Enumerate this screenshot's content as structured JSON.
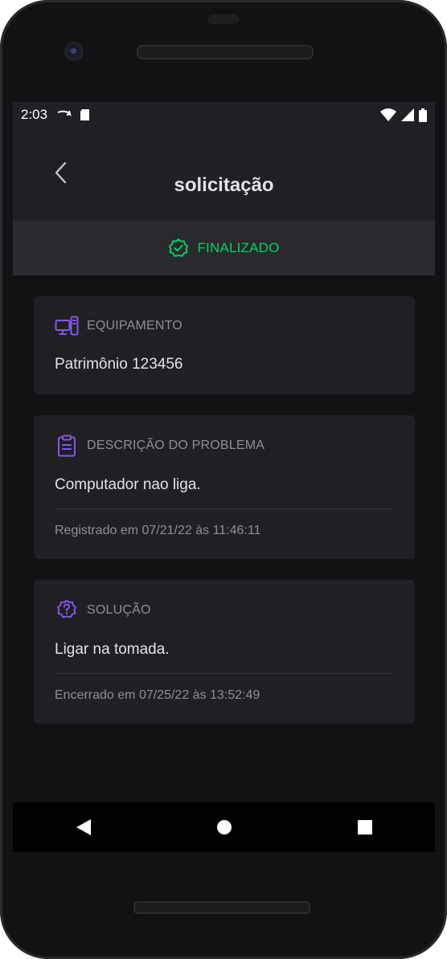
{
  "statusbar": {
    "time": "2:03"
  },
  "header": {
    "title": "solicitação"
  },
  "status": {
    "label": "FINALIZADO",
    "color": "#04d361"
  },
  "cards": [
    {
      "heading": "EQUIPAMENTO",
      "icon": "desktop-tower-icon",
      "value": "Patrimônio 123456"
    },
    {
      "heading": "DESCRIÇÃO DO PROBLEMA",
      "icon": "clipboard-text-icon",
      "value": "Computador nao liga.",
      "meta": "Registrado em 07/21/22 às 11:46:11"
    },
    {
      "heading": "SOLUÇÃO",
      "icon": "cog-question-icon",
      "value": "Ligar na tomada.",
      "meta": "Encerrado em 07/25/22 às 13:52:49"
    }
  ],
  "colors": {
    "accent": "#8257e5",
    "success": "#04d361",
    "background": "#121214",
    "card": "#202024"
  }
}
